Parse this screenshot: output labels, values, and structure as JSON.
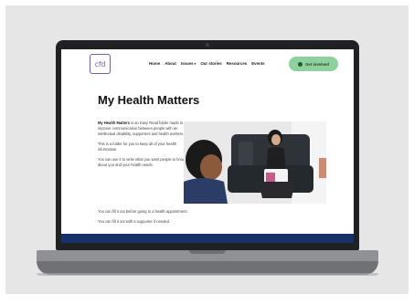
{
  "site": {
    "logo_text": "cfd",
    "nav": [
      {
        "label": "Home"
      },
      {
        "label": "About"
      },
      {
        "label": "Issues",
        "has_dropdown": true
      },
      {
        "label": "Our stories"
      },
      {
        "label": "Resources"
      },
      {
        "label": "Events"
      }
    ],
    "cta_label": "Get involved"
  },
  "page": {
    "title": "My Health Matters",
    "intro_bold": "My Health Matters",
    "intro_rest": " is an Easy Read folder made to improve communication between people with an intellectual disability, supporters and health workers.",
    "para2": "This is a folder for you to keep all of your health information.",
    "para3": "You can use it to write what you want people to know about you and your health needs.",
    "para4": "You can fill it out before going to a health appointment.",
    "para5": "You can fill it out with a supporter if needed."
  },
  "colors": {
    "accent_purple": "#7a5aa8",
    "cta_green": "#8fd19e",
    "footer_navy": "#16306a",
    "laptop_dark": "#202124"
  },
  "icons": {
    "cta": "user-icon",
    "nav_dropdown": "chevron-down-icon"
  }
}
